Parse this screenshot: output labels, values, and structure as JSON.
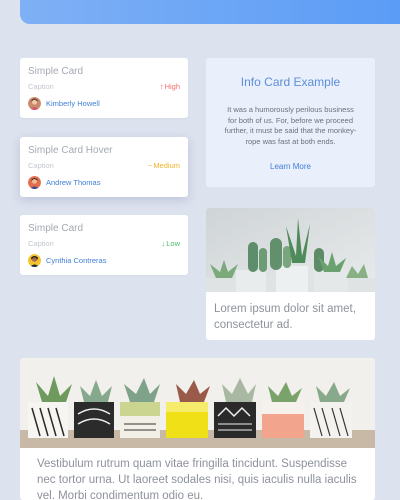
{
  "cards": [
    {
      "title": "Simple Card",
      "caption": "Caption",
      "priority": "High",
      "priority_arrow": "↑",
      "priority_color": "#f2706b",
      "user": "Kimberly Howell"
    },
    {
      "title": "Simple Card Hover",
      "caption": "Caption",
      "priority": "Medium",
      "priority_arrow": "~",
      "priority_color": "#f0b429",
      "user": "Andrew Thomas"
    },
    {
      "title": "Simple Card",
      "caption": "Caption",
      "priority": "Low",
      "priority_arrow": "↓",
      "priority_color": "#4cbd6a",
      "user": "Cynthia Contreras"
    }
  ],
  "info_card": {
    "title": "Info Card Example",
    "text": "It was a humorously perilous business for both of us. For, before we proceed further, it must be said that the monkey-rope was fast at both ends.",
    "link": "Learn More"
  },
  "cactus_card": {
    "text": "Lorem ipsum dolor sit amet, consectetur ad."
  },
  "succulent_card": {
    "text": "Vestibulum rutrum quam vitae fringilla tincidunt. Suspendisse nec tortor urna. Ut laoreet sodales nisi, quis iaculis nulla iaculis vel. Morbi condimentum odio eu."
  },
  "colors": {
    "background": "#dde2ef",
    "accent": "#5b9cf6",
    "link": "#3f7fd6"
  }
}
